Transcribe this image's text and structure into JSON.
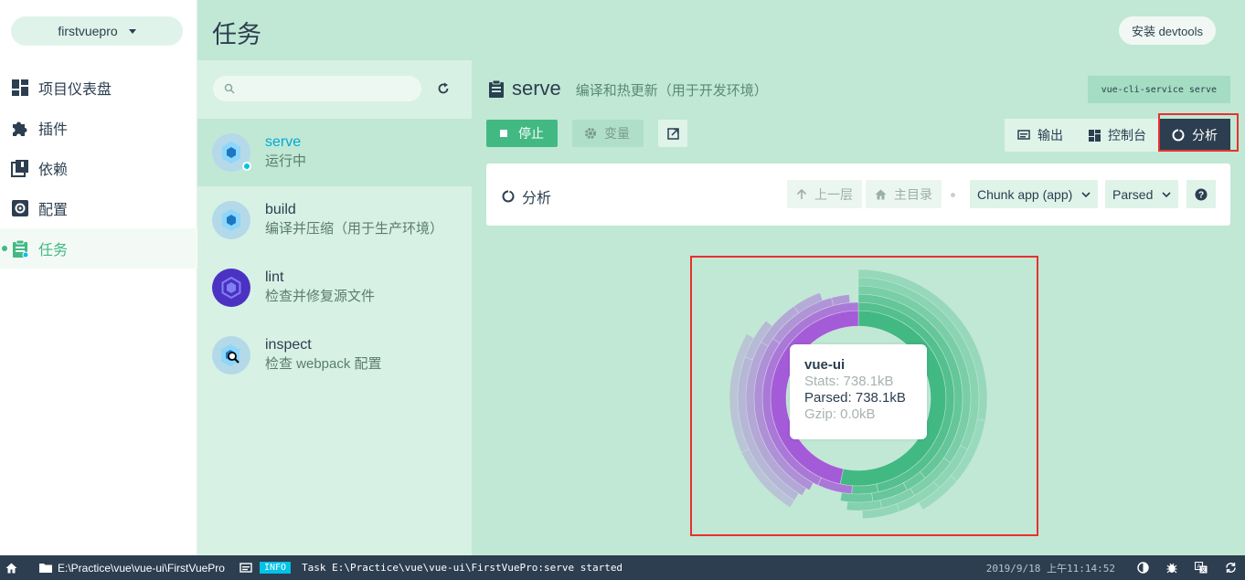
{
  "nav": {
    "project": "firstvuepro",
    "items": [
      {
        "label": "项目仪表盘",
        "icon": "dashboard-icon"
      },
      {
        "label": "插件",
        "icon": "puzzle-icon"
      },
      {
        "label": "依赖",
        "icon": "library-icon"
      },
      {
        "label": "配置",
        "icon": "gear-icon"
      },
      {
        "label": "任务",
        "icon": "clipboard-icon"
      }
    ],
    "active_index": 4
  },
  "header": {
    "title": "任务",
    "devtools_label": "安装 devtools"
  },
  "tasks": {
    "search_placeholder": "",
    "items": [
      {
        "name": "serve",
        "desc": "运行中",
        "icon": "webpack-icon",
        "selected": true,
        "running": true
      },
      {
        "name": "build",
        "desc": "编译并压缩（用于生产环境）",
        "icon": "webpack-icon"
      },
      {
        "name": "lint",
        "desc": "检查并修复源文件",
        "icon": "eslint-icon"
      },
      {
        "name": "inspect",
        "desc": "检查 webpack 配置",
        "icon": "webpack-inspect-icon"
      }
    ]
  },
  "task_detail": {
    "name": "serve",
    "description": "编译和热更新（用于开发环境）",
    "command": "vue-cli-service serve",
    "stop_label": "停止",
    "vars_label": "变量",
    "views": [
      {
        "label": "输出",
        "icon": "terminal-icon"
      },
      {
        "label": "控制台",
        "icon": "dashboard-icon"
      },
      {
        "label": "分析",
        "icon": "spinner-icon"
      }
    ],
    "active_view": 2
  },
  "analyzer": {
    "title": "分析",
    "up_label": "上一层",
    "home_label": "主目录",
    "chunk_select": "Chunk app (app)",
    "size_select": "Parsed",
    "tooltip": {
      "name": "vue-ui",
      "stats": "Stats: 738.1kB",
      "parsed": "Parsed: 738.1kB",
      "gzip": "Gzip: 0.0kB"
    },
    "colors": {
      "green": "#42b983",
      "purple": "#a45bd8"
    }
  },
  "statusbar": {
    "path": "E:\\Practice\\vue\\vue-ui\\FirstVuePro",
    "log_level": "INFO",
    "log_message": "Task E:\\Practice\\vue\\vue-ui\\FirstVuePro:serve started",
    "time": "2019/9/18 上午11:14:52"
  }
}
